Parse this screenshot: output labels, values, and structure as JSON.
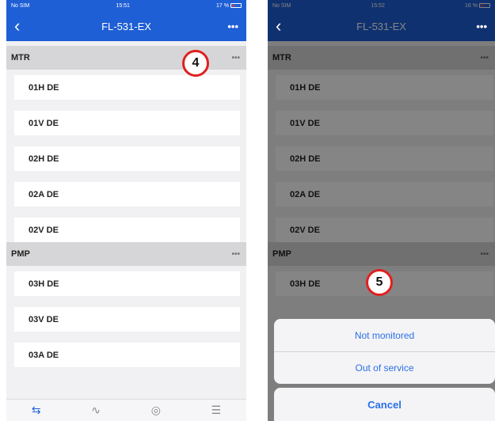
{
  "left": {
    "status": {
      "carrier": "No SIM",
      "time": "15:51",
      "battery": "17 %"
    },
    "nav": {
      "title": "FL-531-EX",
      "more": "•••"
    },
    "groups": [
      {
        "name": "MTR",
        "items": [
          "01H DE",
          "01V DE",
          "02H DE",
          "02A DE",
          "02V DE"
        ]
      },
      {
        "name": "PMP",
        "items": [
          "03H DE",
          "03V DE",
          "03A DE"
        ]
      }
    ],
    "group_more": "•••",
    "callout": "4"
  },
  "right": {
    "status": {
      "carrier": "No SIM",
      "time": "15:52",
      "battery": "16 %"
    },
    "nav": {
      "title": "FL-531-EX",
      "more": "•••"
    },
    "groups": [
      {
        "name": "MTR",
        "items": [
          "01H DE",
          "01V DE",
          "02H DE",
          "02A DE",
          "02V DE"
        ]
      },
      {
        "name": "PMP",
        "items": [
          "03H DE"
        ]
      }
    ],
    "group_more": "•••",
    "callout": "5",
    "action_sheet": {
      "options": [
        "Not monitored",
        "Out of service"
      ],
      "cancel": "Cancel"
    }
  },
  "colors": {
    "nav": "#1f5fd6",
    "action": "#2a6fe8",
    "callout_ring": "#e02020"
  },
  "tab_icons": [
    "route-icon",
    "waveform-icon",
    "disc-icon",
    "list-icon"
  ]
}
